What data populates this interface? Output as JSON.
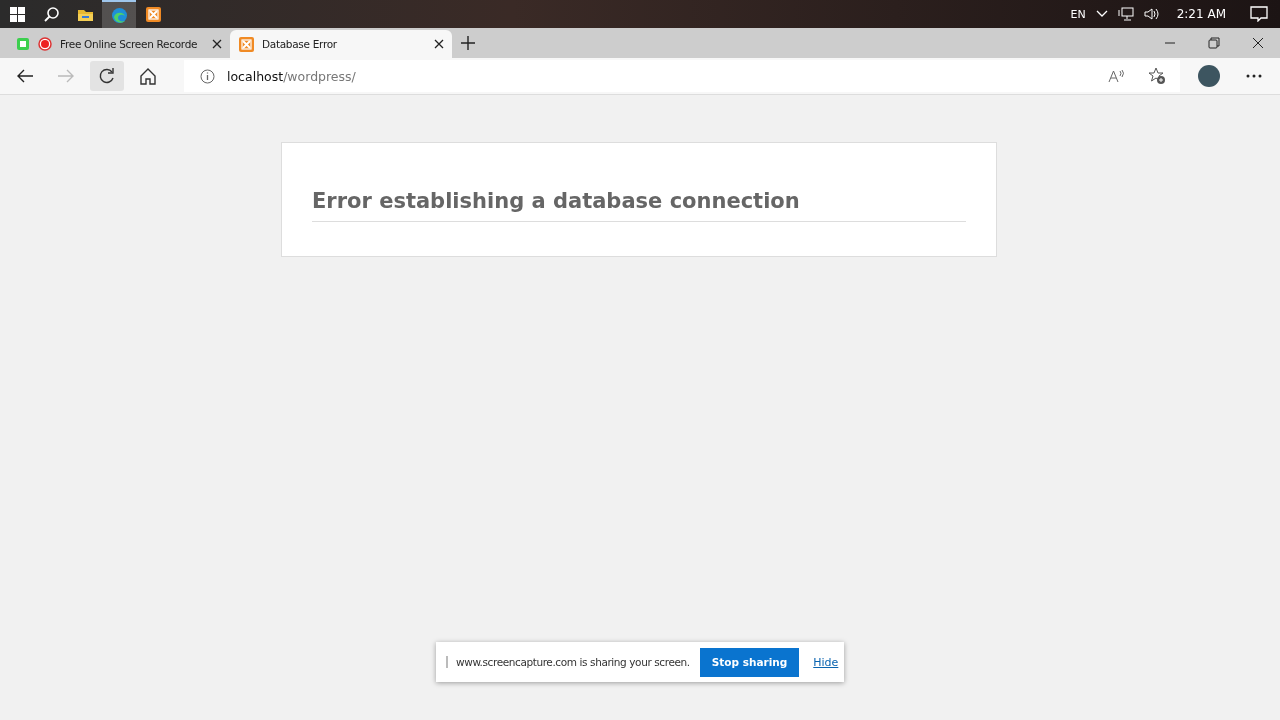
{
  "taskbar": {
    "apps": [
      {
        "kind": "start",
        "selected": false
      },
      {
        "kind": "search",
        "selected": false
      },
      {
        "kind": "folder",
        "selected": false
      },
      {
        "kind": "browser",
        "selected": true
      },
      {
        "kind": "xampp",
        "selected": false
      }
    ],
    "language": "EN",
    "time": "2:21 AM"
  },
  "tabs": [
    {
      "title": "Free Online Screen Recorde",
      "kind": "recorder",
      "selected": false
    },
    {
      "title": "Database Error",
      "kind": "xampp",
      "selected": true
    }
  ],
  "address_bar": {
    "host": "localhost",
    "path": "/wordpress/"
  },
  "page": {
    "heading": "Error establishing a database connection"
  },
  "share_bar": {
    "message": "www.screencapture.com is sharing your screen.",
    "stop_button": "Stop sharing",
    "hide_link": "Hide"
  }
}
